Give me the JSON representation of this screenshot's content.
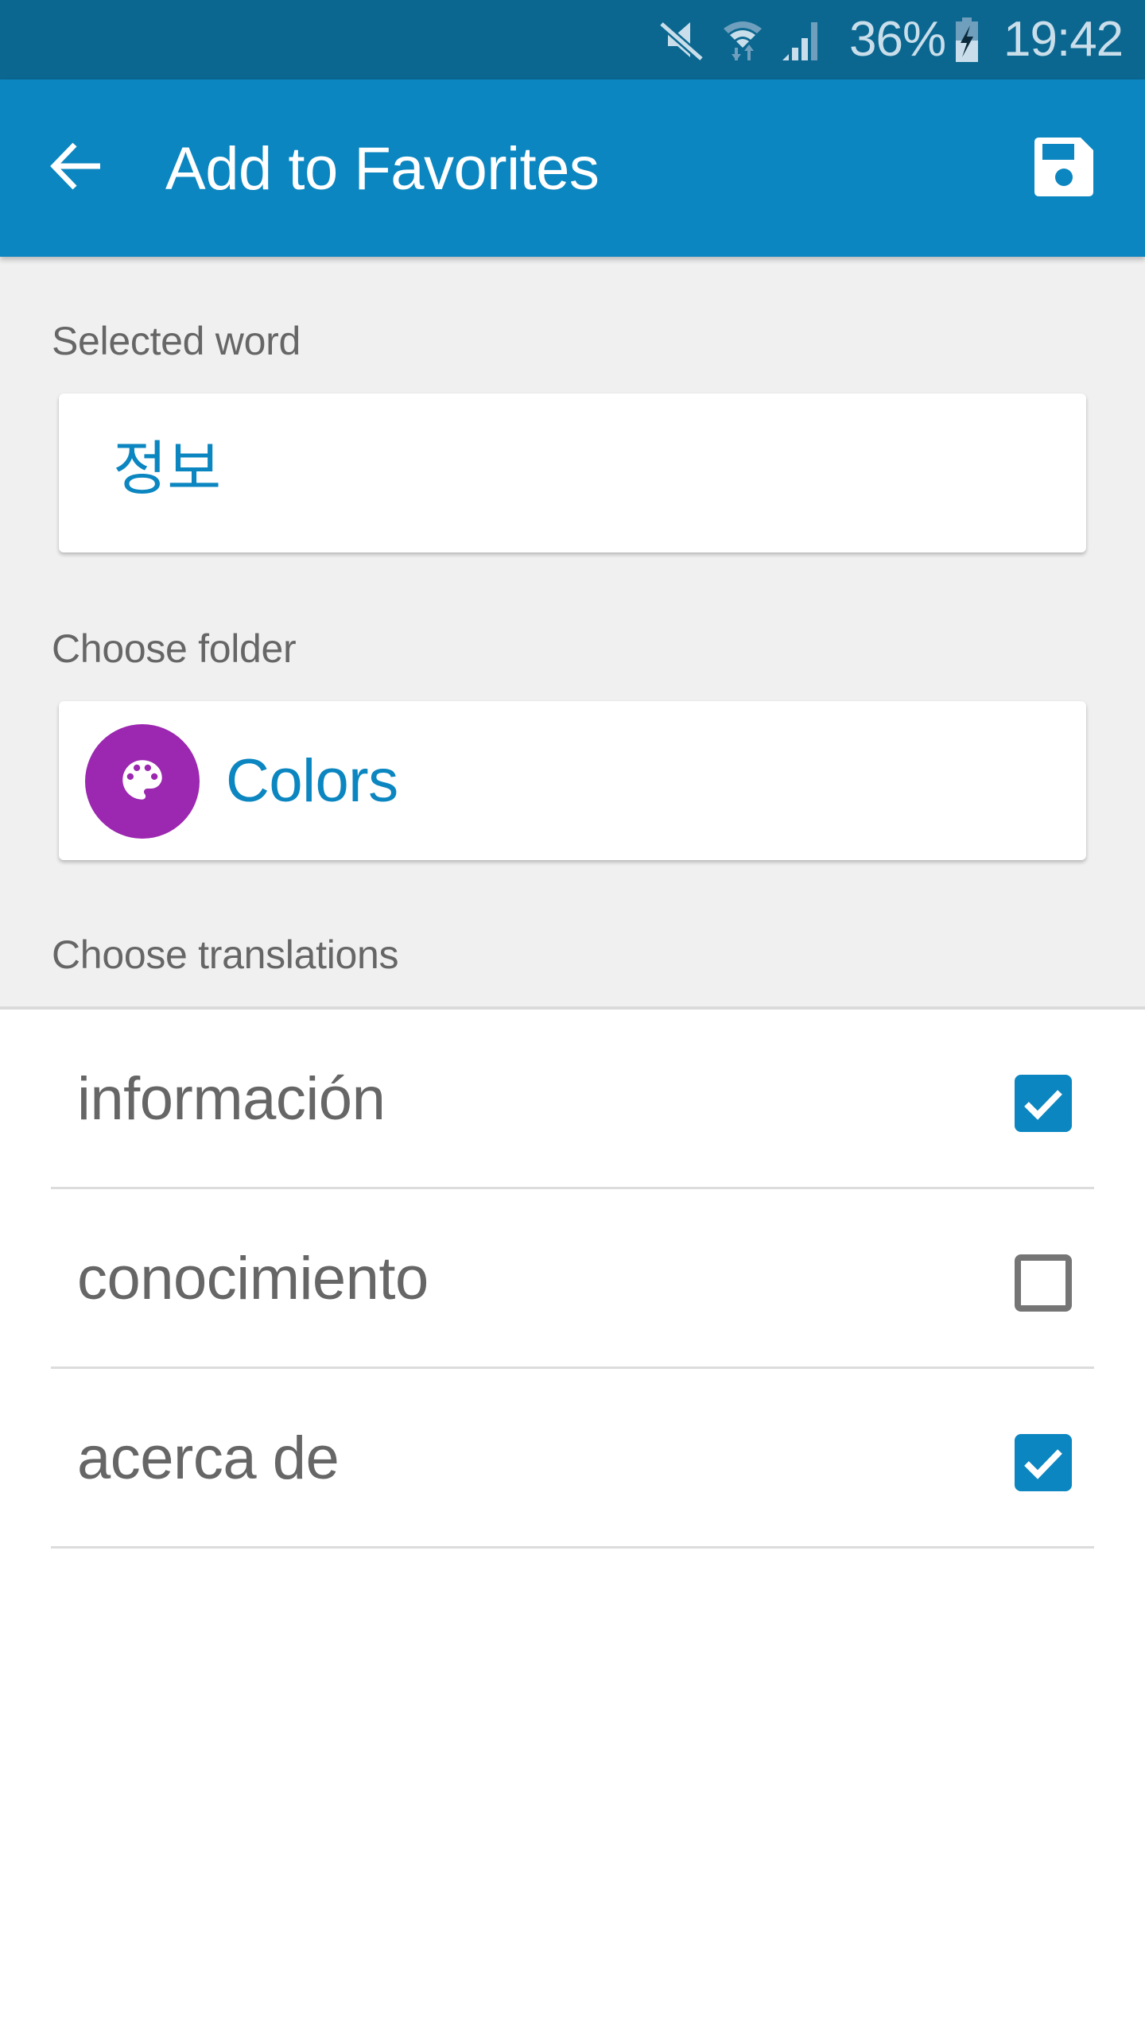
{
  "status_bar": {
    "icons": [
      "mute-icon",
      "wifi-icon",
      "signal-icon",
      "battery-charging-icon"
    ],
    "battery_percent": "36%",
    "time": "19:42",
    "background_color": "#0b6790"
  },
  "app_bar": {
    "back_icon": "arrow-left-icon",
    "title": "Add to Favorites",
    "save_icon": "floppy-disk-icon",
    "background_color": "#0b86c0"
  },
  "selected_word": {
    "label": "Selected word",
    "value": "정보"
  },
  "folder": {
    "label": "Choose folder",
    "name": "Colors",
    "icon": "palette-icon",
    "icon_color": "#9c27b0"
  },
  "translations": {
    "label": "Choose translations",
    "items": [
      {
        "text": "información",
        "checked": true
      },
      {
        "text": "conocimiento",
        "checked": false
      },
      {
        "text": "acerca de",
        "checked": true
      }
    ]
  },
  "colors": {
    "accent": "#0b86c0",
    "label_text": "#666666",
    "background_gray": "#f0f0f0"
  }
}
